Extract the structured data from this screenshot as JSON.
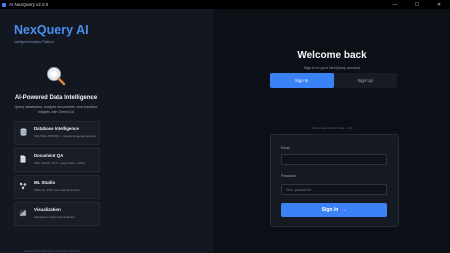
{
  "window": {
    "title": "AI NexQuery v2.0.0",
    "controls": {
      "minimize": "—",
      "maximize": "☐",
      "close": "✕"
    }
  },
  "left_panel": {
    "brand": "NexQuery AI",
    "tagline": "Intelligent Analytics Platform",
    "hero": {
      "icon": "magnifier-icon",
      "title": "AI-Powered Data Intelligence",
      "description": "Query databases, analyze documents, and visualize insights with Gemini AI"
    },
    "features": [
      {
        "icon": "database-icon",
        "title": "Database Intelligence",
        "description": "SQL/SQL (MSSQL) • natural language queries"
      },
      {
        "icon": "document-icon",
        "title": "Document QA",
        "description": "PDF, DOCX, TXT • Large Files + RAG"
      },
      {
        "icon": "brain-icon",
        "title": "ML Studio",
        "description": "Patterns, PCA, Anomaly Detection"
      },
      {
        "icon": "chart-icon",
        "title": "Visualization",
        "description": "Interactive charts and analytics"
      }
    ],
    "footer": "Powered by Gemini AI • Premium Security"
  },
  "auth": {
    "heading": "Welcome back",
    "subheading": "Sign in to your NexQuery account",
    "tabs": [
      {
        "label": "Sign In",
        "active": true
      },
      {
        "label": "Sign Up",
        "active": false
      }
    ],
    "server_note": "Test to these branch cable - v2.0",
    "email_label": "Email",
    "email_value": "",
    "email_placeholder": "",
    "password_label": "Password",
    "password_placeholder": "Your password",
    "submit_label": "Sign In",
    "submit_icon": "arrow-right-icon"
  },
  "colors": {
    "accent": "#3b82f6",
    "brand": "#4a8ef0",
    "background": "#0e1218"
  }
}
